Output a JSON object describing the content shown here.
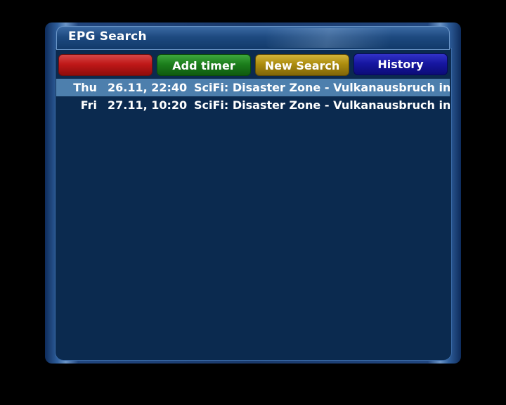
{
  "window": {
    "title": "EPG Search"
  },
  "buttons": {
    "red_label": "",
    "green_label": "Add timer",
    "yellow_label": "New Search",
    "blue_label": "History"
  },
  "colors": {
    "red": "#c01818",
    "green": "#1c7e1c",
    "yellow": "#ac8c0e",
    "blue": "#1616a0",
    "selection": "#4d7fad",
    "background": "#0b2a4f"
  },
  "results": [
    {
      "day": "Thu",
      "datetime": "26.11, 22:40",
      "title": "SciFi: Disaster Zone - Vulkanausbruch in",
      "selected": true
    },
    {
      "day": "Fri",
      "datetime": "27.11, 10:20",
      "title": "SciFi: Disaster Zone - Vulkanausbruch in",
      "selected": false
    }
  ]
}
